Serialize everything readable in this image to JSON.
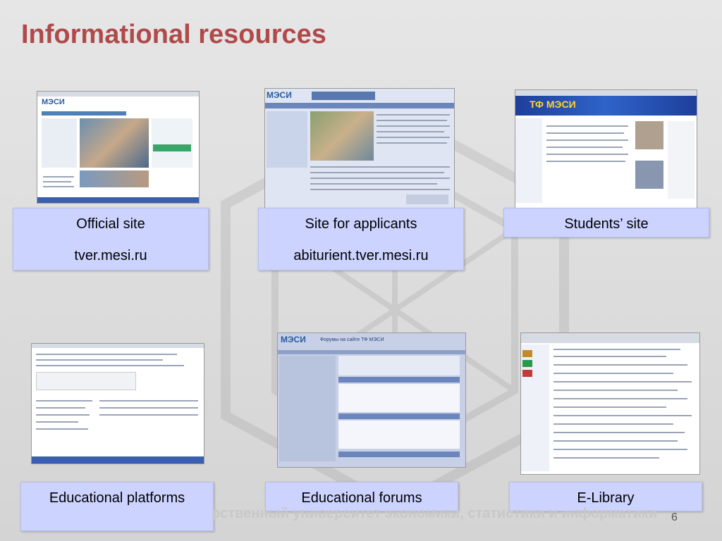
{
  "slide": {
    "title": "Informational resources",
    "page_number": "6",
    "footer_text": "рственный университет экономики, статистики и информатики"
  },
  "resources": [
    {
      "name": "Official site",
      "url": "tver.mesi.ru"
    },
    {
      "name": "Site for applicants",
      "url": "abiturient.tver.mesi.ru"
    },
    {
      "name": "Students’ site",
      "url": ""
    },
    {
      "name": "Educational platforms",
      "url": ""
    },
    {
      "name": "Educational forums",
      "url": ""
    },
    {
      "name": "E-Library",
      "url": ""
    }
  ],
  "screenshots": {
    "official_logo": "МЭСИ",
    "applicants_logo": "МЭСИ",
    "students_banner": "ТФ МЭСИ",
    "forums_logo": "МЭСИ",
    "forums_header": "Форумы на сайте ТФ МЭСИ"
  },
  "colors": {
    "title": "#b04a4a",
    "label_bg": "#ccd3ff"
  }
}
